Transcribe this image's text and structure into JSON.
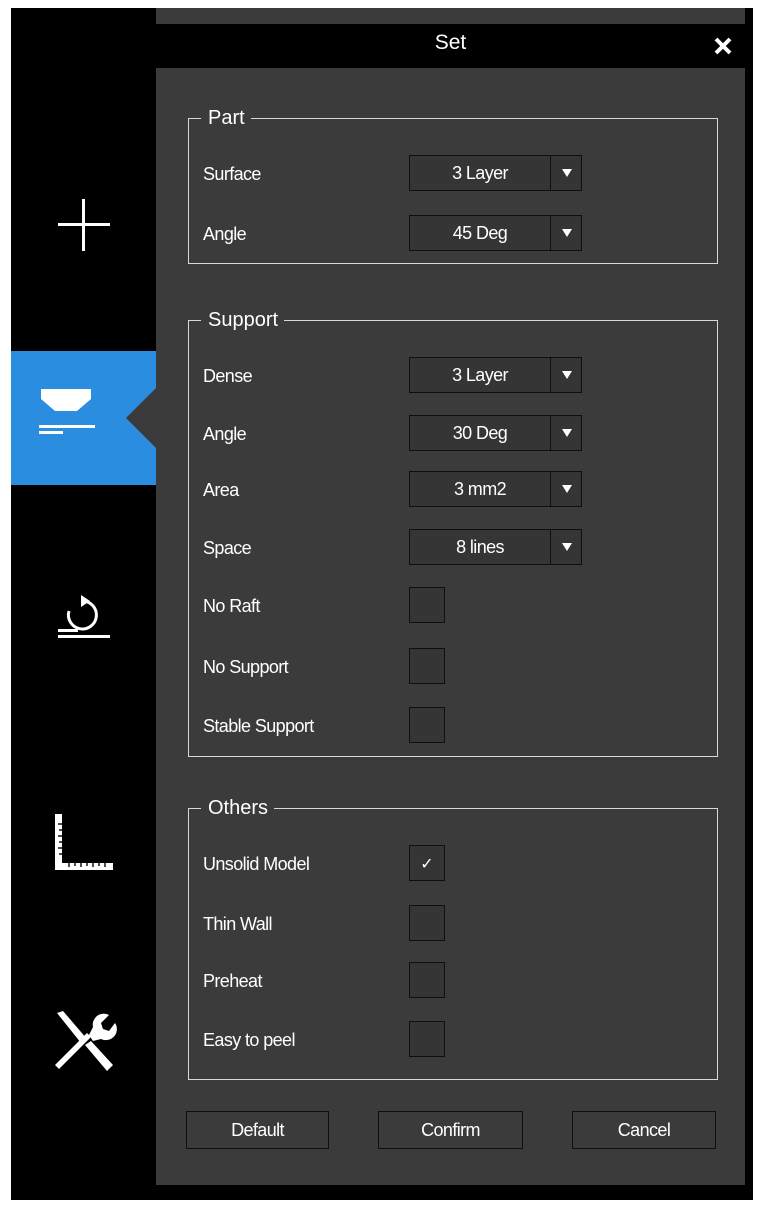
{
  "window": {
    "title": "Set",
    "close_icon": "close-icon",
    "colors": {
      "panel": "#3b3b3b",
      "titlebar": "#000000",
      "accent": "#2a8de0",
      "text": "#ffffff"
    }
  },
  "sidebar": {
    "items": [
      {
        "name": "add",
        "icon": "plus-icon",
        "active": false
      },
      {
        "name": "print-settings",
        "icon": "nozzle-layer-icon",
        "active": true
      },
      {
        "name": "rotate",
        "icon": "rotate-platform-icon",
        "active": false
      },
      {
        "name": "measure",
        "icon": "ruler-icon",
        "active": false
      },
      {
        "name": "tools",
        "icon": "wrench-screwdriver-icon",
        "active": false
      }
    ]
  },
  "part": {
    "legend": "Part",
    "surface": {
      "label": "Surface",
      "value": "3 Layer"
    },
    "angle": {
      "label": "Angle",
      "value": "45 Deg"
    }
  },
  "support": {
    "legend": "Support",
    "dense": {
      "label": "Dense",
      "value": "3 Layer"
    },
    "angle": {
      "label": "Angle",
      "value": "30 Deg"
    },
    "area": {
      "label": "Area",
      "value": "3 mm2"
    },
    "space": {
      "label": "Space",
      "value": "8 lines"
    },
    "no_raft": {
      "label": "No Raft",
      "checked": false
    },
    "no_support": {
      "label": "No Support",
      "checked": false
    },
    "stable_support": {
      "label": "Stable Support",
      "checked": false
    }
  },
  "others": {
    "legend": "Others",
    "unsolid_model": {
      "label": "Unsolid Model",
      "checked": true,
      "mark": "✓"
    },
    "thin_wall": {
      "label": "Thin Wall",
      "checked": false
    },
    "preheat": {
      "label": "Preheat",
      "checked": false
    },
    "easy_to_peel": {
      "label": "Easy to peel",
      "checked": false
    }
  },
  "buttons": {
    "default": "Default",
    "confirm": "Confirm",
    "cancel": "Cancel"
  }
}
